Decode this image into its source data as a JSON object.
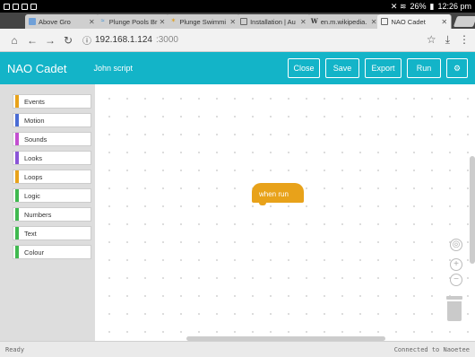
{
  "statusbar": {
    "battery": "26%",
    "time": "12:26 pm"
  },
  "browser": {
    "tabs": [
      {
        "title": "Above Gro",
        "favicon": "picture-icon",
        "active": false
      },
      {
        "title": "Plunge Pools Br",
        "favicon": "pool-icon",
        "active": false
      },
      {
        "title": "Plunge Swimmi",
        "favicon": "star-icon",
        "active": false
      },
      {
        "title": "Installation | Au",
        "favicon": "page-icon",
        "active": false
      },
      {
        "title": "en.m.wikipedia.",
        "favicon": "wikipedia-icon",
        "active": false
      },
      {
        "title": "NAO Cadet",
        "favicon": "page-icon",
        "active": true
      }
    ],
    "url_host": "192.168.1.124",
    "url_port": ":3000"
  },
  "app": {
    "title": "NAO Cadet",
    "script_name": "John script",
    "buttons": {
      "close": "Close",
      "save": "Save",
      "export": "Export",
      "run": "Run"
    }
  },
  "toolbox": {
    "categories": [
      {
        "label": "Events",
        "color": "#e8a21a"
      },
      {
        "label": "Motion",
        "color": "#4a6cd4"
      },
      {
        "label": "Sounds",
        "color": "#c34fd0"
      },
      {
        "label": "Looks",
        "color": "#8a55d7"
      },
      {
        "label": "Loops",
        "color": "#e8a21a"
      },
      {
        "label": "Logic",
        "color": "#3fb94f"
      },
      {
        "label": "Numbers",
        "color": "#3fb94f"
      },
      {
        "label": "Text",
        "color": "#3fb94f"
      },
      {
        "label": "Colour",
        "color": "#3fb94f"
      }
    ]
  },
  "workspace": {
    "hat_block_label": "when run"
  },
  "footer": {
    "left": "Ready",
    "right": "Connected to Naoetee"
  },
  "colors": {
    "accent": "#13b4c8",
    "events": "#e8a21a"
  }
}
